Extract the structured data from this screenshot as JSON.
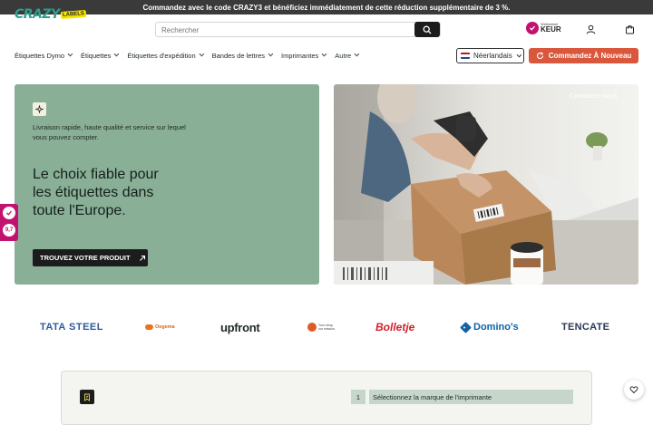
{
  "promo_bar": {
    "text": "Commandez avec le code CRAZY3 et bénéficiez immédiatement de cette réduction supplémentaire de 3 %."
  },
  "header": {
    "logo_text": "CRAZY",
    "logo_badge": "LABELS",
    "search": {
      "placeholder": "Rechercher"
    },
    "trust_badge": {
      "small": "Webwinkel",
      "big": "KEUR"
    }
  },
  "nav": {
    "items": [
      {
        "label": "Étiquettes Dymo"
      },
      {
        "label": "Étiquettes"
      },
      {
        "label": "Étiquettes d'expédition"
      },
      {
        "label": "Bandes de lettres"
      },
      {
        "label": "Imprimantes"
      },
      {
        "label": "Autre"
      }
    ],
    "language": "Néerlandais",
    "reorder_label": "Commandez À Nouveau"
  },
  "hero": {
    "tagline": "Livraison rapide, haute qualité et service sur lequel vous pouvez compter.",
    "headline": "Le choix fiable pour les étiquettes dans toute l'Europe.",
    "cta_label": "TROUVEZ VOTRE PRODUIT",
    "contact_label": "Contactez-nous"
  },
  "side_badge": {
    "score": "9,7"
  },
  "brands": [
    "TATA STEEL",
    "Oegema",
    "upfront",
    "Your story, our mission.",
    "Bolletje",
    "Domino's",
    "TENCATE"
  ],
  "finder": {
    "step_number": "1",
    "step_label": "Sélectionnez la marque de l'imprimante"
  },
  "colors": {
    "accent": "#d9573d",
    "hero_green": "#8aaf97",
    "brand_teal": "#2f9e8c",
    "keur_pink": "#c2126f"
  }
}
